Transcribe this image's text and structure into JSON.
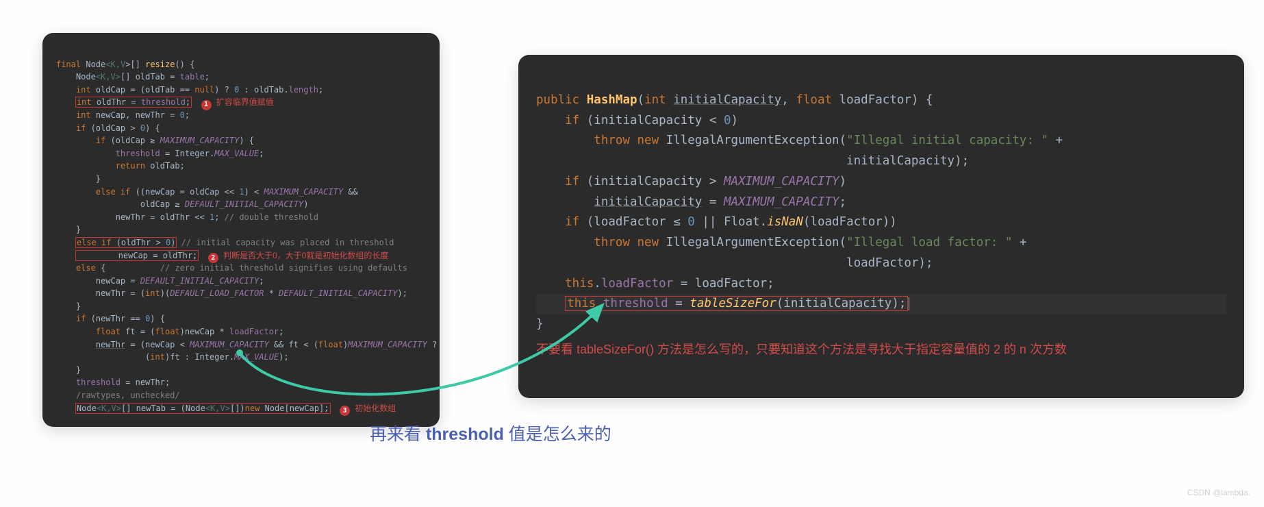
{
  "left": {
    "anno1": "扩容临界值赋值",
    "anno2": "判断是否大于0，大于0就是初始化数组的长度",
    "anno3": "初始化数组",
    "code": {
      "l1a": "final",
      "l1b": " Node",
      "l1c": "<",
      "l1d": "K",
      "l1e": ",",
      "l1f": "V",
      "l1g": ">[] ",
      "l1h": "resize",
      "l1i": "() {",
      "l2a": "    Node",
      "l2c": "<",
      "l2d": "K",
      "l2e": ",",
      "l2f": "V",
      "l2g": ">",
      "l2h": "[] oldTab = ",
      "l2i": "table",
      "l2j": ";",
      "l3a": "    int ",
      "l3b": "oldCap = (oldTab == ",
      "l3c": "null",
      "l3d": ") ? ",
      "l3e": "0",
      "l3f": " : oldTab.",
      "l3g": "length",
      "l3h": ";",
      "l4a": "    ",
      "l4b": "int ",
      "l4c": "oldThr = ",
      "l4d": "threshold",
      "l4e": ";",
      "l5a": "    int ",
      "l5b": "newCap, newThr = ",
      "l5c": "0",
      "l5d": ";",
      "l6a": "    if ",
      "l6b": "(oldCap > ",
      "l6c": "0",
      "l6d": ") {",
      "l7a": "        if ",
      "l7b": "(oldCap ≥ ",
      "l7c": "MAXIMUM_CAPACITY",
      "l7d": ") {",
      "l8a": "            ",
      "l8b": "threshold",
      "l8c": " = Integer.",
      "l8d": "MAX_VALUE",
      "l8e": ";",
      "l9a": "            return ",
      "l9b": "oldTab;",
      "l10": "        }",
      "l11a": "        else if ",
      "l11b": "((newCap = oldCap << ",
      "l11c": "1",
      "l11d": ") < ",
      "l11e": "MAXIMUM_CAPACITY",
      "l11f": " &&",
      "l12a": "                 oldCap ≥ ",
      "l12b": "DEFAULT_INITIAL_CAPACITY",
      "l12c": ")",
      "l13a": "            newThr = oldThr << ",
      "l13b": "1",
      "l13c": "; ",
      "l13d": "// double threshold",
      "l14": "    }",
      "l15a": "    ",
      "l15b": "else if ",
      "l15c": "(oldThr > ",
      "l15d": "0",
      "l15e": ")",
      "l15f": " // initial capacity was placed in threshold",
      "l16a": "        newCap = oldThr;",
      "l17a": "    else ",
      "l17b": "{",
      "l17c": "           // zero initial threshold signifies using defaults",
      "l18a": "        newCap = ",
      "l18b": "DEFAULT_INITIAL_CAPACITY",
      "l18c": ";",
      "l19a": "        newThr = (",
      "l19b": "int",
      "l19c": ")(",
      "l19d": "DEFAULT_LOAD_FACTOR",
      "l19e": " * ",
      "l19f": "DEFAULT_INITIAL_CAPACITY",
      "l19g": ");",
      "l20": "    }",
      "l21a": "    if ",
      "l21b": "(newThr == ",
      "l21c": "0",
      "l21d": ") {",
      "l22a": "        float ",
      "l22b": "ft = (",
      "l22c": "float",
      "l22d": ")newCap * ",
      "l22e": "loadFactor",
      "l22f": ";",
      "l23a": "        ",
      "l23b": "newThr",
      "l23c": " = (newCap < ",
      "l23d": "MAXIMUM_CAPACITY",
      "l23e": " && ft < (",
      "l23f": "float",
      "l23g": ")",
      "l23h": "MAXIMUM_CAPACITY",
      "l23i": " ?",
      "l24a": "                  (",
      "l24b": "int",
      "l24c": ")ft : Integer.",
      "l24d": "MAX_VALUE",
      "l24e": ");",
      "l25": "    }",
      "l26a": "    ",
      "l26b": "threshold",
      "l26c": " = newThr;",
      "l27a": "    ",
      "l27b": "/rawtypes, unchecked/",
      "l28a": "    ",
      "l28b": "Node",
      "l28c": "<",
      "l28d": "K",
      "l28e": ",",
      "l28f": "V",
      "l28g": ">",
      "l28h": "[] newTab = (Node",
      "l28i": "<",
      "l28j": "K",
      "l28k": ",",
      "l28l": "V",
      "l28m": ">",
      "l28n": "[])",
      "l28o": "new ",
      "l28p": "Node[newCap];"
    }
  },
  "right": {
    "anno": "不要看 tableSizeFor() 方法是怎么写的，只要知道这个方法是寻找大于指定容量值的 2 的 n 次方数",
    "code": {
      "l1a": "public ",
      "l1b": "HashMap",
      "l1c": "(",
      "l1d": "int ",
      "l1e": "initialCapacity",
      "l1f": ", ",
      "l1g": "float ",
      "l1h": "loadFactor) {",
      "l2a": "    if ",
      "l2b": "(initialCapacity < ",
      "l2c": "0",
      "l2d": ")",
      "l3a": "        throw new ",
      "l3b": "IllegalArgumentException(",
      "l3c": "\"Illegal initial capacity: \"",
      "l3d": " +",
      "l4a": "                                           initialCapacity);",
      "l5a": "    if ",
      "l5b": "(initialCapacity > ",
      "l5c": "MAXIMUM_CAPACITY",
      "l5d": ")",
      "l6a": "        ",
      "l6b": "initialCapacity",
      "l6c": " = ",
      "l6d": "MAXIMUM_CAPACITY",
      "l6e": ";",
      "l7a": "    if ",
      "l7b": "(loadFactor ≤ ",
      "l7c": "0",
      "l7d": " || Float.",
      "l7e": "isNaN",
      "l7f": "(loadFactor))",
      "l8a": "        throw new ",
      "l8b": "IllegalArgumentException(",
      "l8c": "\"Illegal load factor: \"",
      "l8d": " +",
      "l9a": "                                           loadFactor);",
      "l10a": "    this",
      "l10b": ".",
      "l10c": "loadFactor",
      "l10d": " = loadFactor;",
      "l11a": "    ",
      "l11b": "this",
      "l11c": ".",
      "l11d": "threshold",
      "l11e": " = ",
      "l11f": "tableSizeFor",
      "l11g": "(",
      "l11h": "initialCapacity",
      "l11i": ");",
      "l12": "}"
    }
  },
  "caption_a": "再来看 ",
  "caption_b": "threshold",
  "caption_c": " 值是怎么来的",
  "watermark": "CSDN @lambda."
}
